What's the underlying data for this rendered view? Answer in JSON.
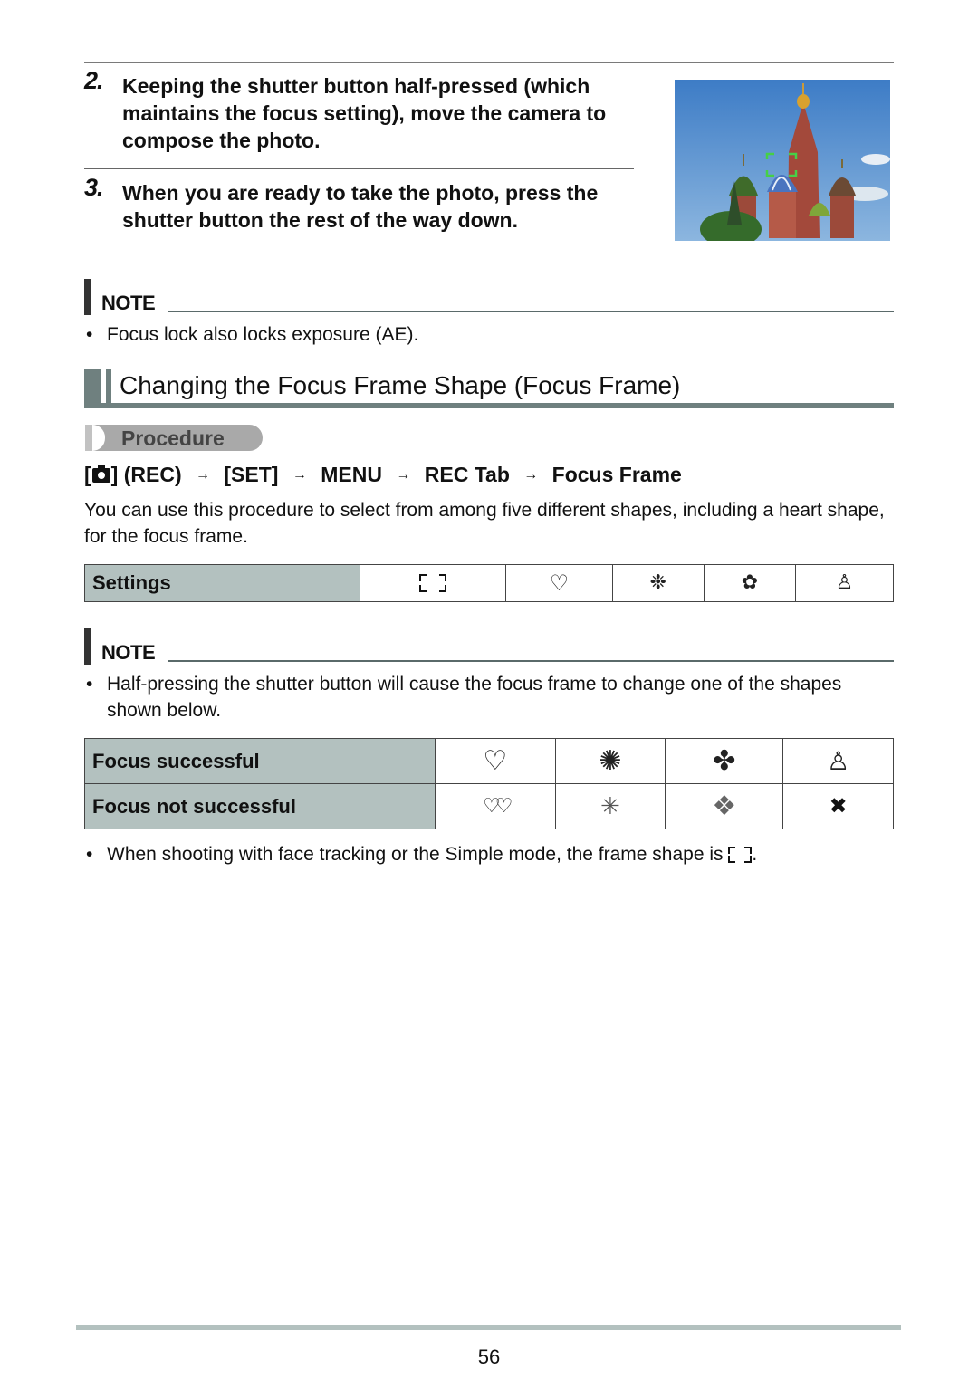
{
  "steps": [
    {
      "number": "2.",
      "text": "Keeping the shutter button half-pressed (which maintains the focus setting), move the camera to compose the photo."
    },
    {
      "number": "3.",
      "text": "When you are ready to take the photo, press the shutter button the rest of the way down."
    }
  ],
  "photo": {
    "alt": "Saint Basil's Cathedral with green focus frame brackets"
  },
  "note1": {
    "label": "NOTE",
    "bullets": [
      "Focus lock also locks exposure (AE)."
    ]
  },
  "section": {
    "title": "Changing the Focus Frame Shape (Focus Frame)",
    "procedure_label": "Procedure",
    "menu_path": {
      "open": "[",
      "camera_icon": "camera-icon",
      "close": "] (REC)",
      "arrow": "→",
      "steps": [
        "[SET]",
        "MENU",
        "REC Tab",
        "Focus Frame"
      ]
    },
    "description": "You can use this procedure to select from among five different shapes, including a heart shape, for the focus frame."
  },
  "settings_table": {
    "header": "Settings",
    "options": [
      {
        "icon": "bracket-frame-icon",
        "glyph": ""
      },
      {
        "icon": "heart-icon",
        "glyph": "♡"
      },
      {
        "icon": "snowflake-icon",
        "glyph": "❉"
      },
      {
        "icon": "flower-icon",
        "glyph": "✿"
      },
      {
        "icon": "gingerbread-icon",
        "glyph": "♙"
      }
    ]
  },
  "note2": {
    "label": "NOTE",
    "bullets": [
      "Half-pressing the shutter button will cause the focus frame to change one of the shapes shown below.",
      "When shooting with face tracking or the Simple mode, the frame shape is"
    ],
    "bullet2_suffix": "."
  },
  "focus_table": {
    "rows": [
      {
        "label": "Focus successful",
        "icons": [
          {
            "icon": "heart-icon",
            "glyph": "♡"
          },
          {
            "icon": "sparkle-burst-icon",
            "glyph": "✺"
          },
          {
            "icon": "flower-outline-icon",
            "glyph": "✤"
          },
          {
            "icon": "gingerbread-icon",
            "glyph": "♙"
          }
        ]
      },
      {
        "label": "Focus not successful",
        "icons": [
          {
            "icon": "broken-heart-icon",
            "glyph": "♡♡"
          },
          {
            "icon": "small-burst-icon",
            "glyph": "✳"
          },
          {
            "icon": "scattered-flowers-icon",
            "glyph": "❖"
          },
          {
            "icon": "x-mark-icon",
            "glyph": "✖"
          }
        ]
      }
    ]
  },
  "footer": {
    "page_number": "56"
  }
}
